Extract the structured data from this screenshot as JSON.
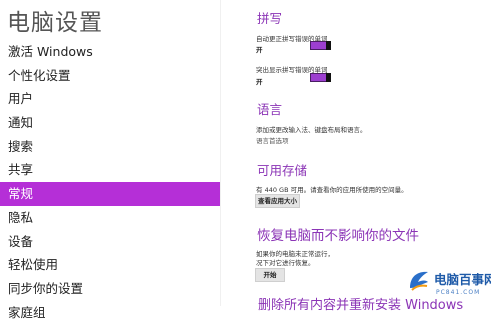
{
  "sidebar": {
    "title": "电脑设置",
    "items": [
      {
        "label": "激活 Windows"
      },
      {
        "label": "个性化设置"
      },
      {
        "label": "用户"
      },
      {
        "label": "通知"
      },
      {
        "label": "搜索"
      },
      {
        "label": "共享"
      },
      {
        "label": "常规",
        "active": true
      },
      {
        "label": "隐私"
      },
      {
        "label": "设备"
      },
      {
        "label": "轻松使用"
      },
      {
        "label": "同步你的设置"
      },
      {
        "label": "家庭组"
      }
    ]
  },
  "spelling": {
    "title": "拼写",
    "autocorrect_label": "自动更正拼写错误的单词",
    "autocorrect_state": "开",
    "highlight_label": "突出显示拼写错误的单词",
    "highlight_state": "开"
  },
  "language": {
    "title": "语言",
    "description": "添加或更改输入法、键盘布局和语言。",
    "link": "语言首选项"
  },
  "storage": {
    "title": "可用存储",
    "description": "有 440 GB 可用。请查看你的应用所使用的空间量。",
    "button": "查看应用大小"
  },
  "refresh": {
    "title": "恢复电脑而不影响你的文件",
    "desc_line1": "如果你的电脑未正常运行，",
    "desc_line2": "况下对它进行恢复。",
    "button": "开始"
  },
  "reinstall": {
    "title_partial": "删除所有内容并重新安装 Windows"
  },
  "watermark": {
    "brand": "电脑百事网",
    "url": "PC841.COM"
  },
  "colors": {
    "accent": "#b52fd7",
    "heading": "#8b34b6",
    "toggle_on": "#9d3fd0"
  }
}
